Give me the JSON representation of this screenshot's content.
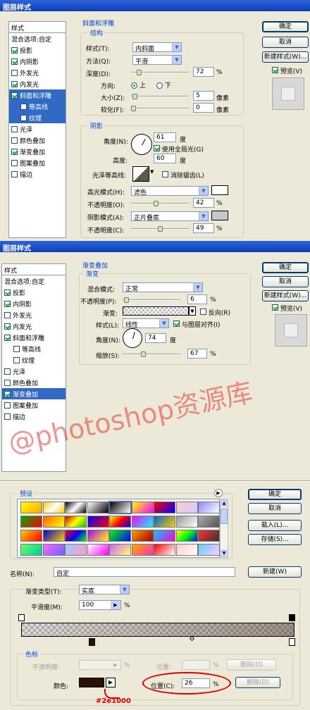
{
  "panel1": {
    "title": "图层样式",
    "style_list": {
      "header": "样式",
      "items": [
        {
          "label": "混合选项:自定",
          "checkbox": false,
          "checked": false,
          "selected": false,
          "sub": false
        },
        {
          "label": "投影",
          "checkbox": true,
          "checked": true,
          "selected": false,
          "sub": false
        },
        {
          "label": "内阴影",
          "checkbox": true,
          "checked": true,
          "selected": false,
          "sub": false
        },
        {
          "label": "外发光",
          "checkbox": true,
          "checked": false,
          "selected": false,
          "sub": false
        },
        {
          "label": "内发光",
          "checkbox": true,
          "checked": true,
          "selected": false,
          "sub": false
        },
        {
          "label": "斜面和浮雕",
          "checkbox": true,
          "checked": true,
          "selected": true,
          "sub": false
        },
        {
          "label": "等高线",
          "checkbox": true,
          "checked": false,
          "selected": true,
          "sub": true
        },
        {
          "label": "纹理",
          "checkbox": true,
          "checked": false,
          "selected": true,
          "sub": true
        },
        {
          "label": "光泽",
          "checkbox": true,
          "checked": false,
          "selected": false,
          "sub": false
        },
        {
          "label": "颜色叠加",
          "checkbox": true,
          "checked": false,
          "selected": false,
          "sub": false
        },
        {
          "label": "渐变叠加",
          "checkbox": true,
          "checked": true,
          "selected": false,
          "sub": false
        },
        {
          "label": "图案叠加",
          "checkbox": true,
          "checked": false,
          "selected": false,
          "sub": false
        },
        {
          "label": "描边",
          "checkbox": true,
          "checked": false,
          "selected": false,
          "sub": false
        }
      ]
    },
    "section_title": "斜面和浮雕",
    "structure": {
      "legend": "结构",
      "style_label": "样式(T):",
      "style_value": "内斜面",
      "method_label": "方法(Q):",
      "method_value": "平滑",
      "depth_label": "深度(D):",
      "depth_value": "72",
      "depth_unit": "%",
      "direction_label": "方向:",
      "dir_up": "上",
      "dir_down": "下",
      "size_label": "大小(Z):",
      "size_value": "5",
      "size_unit": "像素",
      "soften_label": "软化(F):",
      "soften_value": "0",
      "soften_unit": "像素"
    },
    "shading": {
      "legend": "阴影",
      "angle_label": "角度(N):",
      "angle_value": "61",
      "angle_unit": "度",
      "global_light_label": "使用全局光(G)",
      "altitude_label": "高度:",
      "altitude_value": "60",
      "altitude_unit": "度",
      "gloss_label": "光泽等高线:",
      "anti_alias_label": "消除锯齿(L)",
      "highlight_mode_label": "高光模式(H):",
      "highlight_mode_value": "滤色",
      "highlight_opacity_label": "不透明度(O):",
      "highlight_opacity_value": "42",
      "highlight_opacity_unit": "%",
      "shadow_mode_label": "阴影模式(A):",
      "shadow_mode_value": "正片叠底",
      "shadow_opacity_label": "不透明度(C):",
      "shadow_opacity_value": "49",
      "shadow_opacity_unit": "%"
    },
    "buttons": {
      "ok": "确定",
      "cancel": "取消",
      "new_style": "新建样式(W)...",
      "preview": "预览(V)"
    }
  },
  "panel2": {
    "title": "图层样式",
    "style_list": {
      "header": "样式",
      "items": [
        {
          "label": "混合选项:自定",
          "checkbox": false,
          "checked": false,
          "selected": false,
          "sub": false
        },
        {
          "label": "投影",
          "checkbox": true,
          "checked": true,
          "selected": false,
          "sub": false
        },
        {
          "label": "内阴影",
          "checkbox": true,
          "checked": true,
          "selected": false,
          "sub": false
        },
        {
          "label": "外发光",
          "checkbox": true,
          "checked": false,
          "selected": false,
          "sub": false
        },
        {
          "label": "内发光",
          "checkbox": true,
          "checked": true,
          "selected": false,
          "sub": false
        },
        {
          "label": "斜面和浮雕",
          "checkbox": true,
          "checked": true,
          "selected": false,
          "sub": false
        },
        {
          "label": "等高线",
          "checkbox": true,
          "checked": false,
          "selected": false,
          "sub": true
        },
        {
          "label": "纹理",
          "checkbox": true,
          "checked": false,
          "selected": false,
          "sub": true
        },
        {
          "label": "光泽",
          "checkbox": true,
          "checked": false,
          "selected": false,
          "sub": false
        },
        {
          "label": "颜色叠加",
          "checkbox": true,
          "checked": false,
          "selected": false,
          "sub": false
        },
        {
          "label": "渐变叠加",
          "checkbox": true,
          "checked": true,
          "selected": true,
          "sub": false
        },
        {
          "label": "图案叠加",
          "checkbox": true,
          "checked": false,
          "selected": false,
          "sub": false
        },
        {
          "label": "描边",
          "checkbox": true,
          "checked": false,
          "selected": false,
          "sub": false
        }
      ]
    },
    "section_title": "渐变叠加",
    "gradient": {
      "legend": "渐变",
      "blend_label": "混合模式:",
      "blend_value": "正常",
      "opacity_label": "不透明度(P):",
      "opacity_value": "6",
      "opacity_unit": "%",
      "gradient_label": "渐变:",
      "reverse_label": "反向(R)",
      "style_label": "样式(L):",
      "style_value": "线性",
      "align_label": "与图层对齐(I)",
      "angle_label": "角度(N):",
      "angle_value": "74",
      "angle_unit": "度",
      "scale_label": "缩放(S):",
      "scale_value": "67",
      "scale_unit": "%"
    },
    "buttons": {
      "ok": "确定",
      "cancel": "取消",
      "new_style": "新建样式(W)...",
      "preview": "预览(V)"
    },
    "watermark": "@photoshop资源库"
  },
  "panel3": {
    "presets_legend": "预设",
    "buttons": {
      "ok": "确定",
      "cancel": "取消",
      "load": "载入(L)...",
      "save": "存储(S)...",
      "new": "新建(W)"
    },
    "name_label": "名称(N):",
    "name_value": "自定",
    "type_label": "渐变类型(T):",
    "type_value": "实底",
    "smooth_label": "平滑度(M):",
    "smooth_value": "100",
    "smooth_unit": "%",
    "stops_legend": "色标",
    "opacity_label": "不透明度:",
    "opacity_unit": "%",
    "position_label": "位置:",
    "position_unit": "%",
    "delete_label": "删除(D)",
    "color_label": "颜色:",
    "position2_label": "位置(C):",
    "position2_value": "26",
    "position2_unit": "%",
    "delete2_label": "删除(D)",
    "color_annotation": "#2e1000"
  },
  "colors": {
    "stop_color": "#2e1000",
    "title_bar": "#0a3fb8",
    "selection": "#316ac5",
    "annotation": "#e00000"
  }
}
